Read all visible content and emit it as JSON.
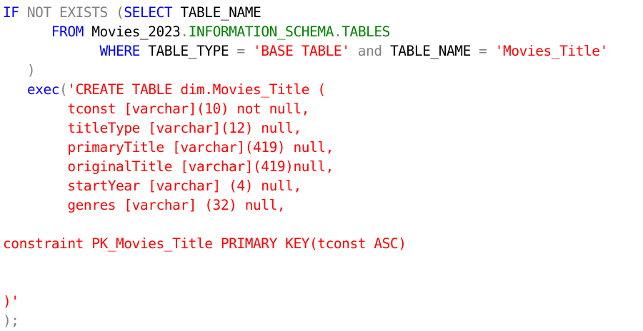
{
  "editor": {
    "colors": {
      "keyword": "#0000ff",
      "operator": "#808080",
      "system_object": "#008000",
      "string": "#ff0000",
      "identifier": "#000000"
    },
    "lines": [
      {
        "tokens": [
          {
            "text": "IF",
            "type": "kw"
          },
          {
            "text": " NOT EXISTS (",
            "type": "gray"
          },
          {
            "text": "SELECT",
            "type": "kw"
          },
          {
            "text": " TABLE_NAME",
            "type": "id"
          }
        ]
      },
      {
        "tokens": [
          {
            "text": "      ",
            "type": "id"
          },
          {
            "text": "FROM",
            "type": "kw"
          },
          {
            "text": " Movies_2023",
            "type": "id"
          },
          {
            "text": ".",
            "type": "gray"
          },
          {
            "text": "INFORMATION_SCHEMA",
            "type": "sys"
          },
          {
            "text": ".",
            "type": "gray"
          },
          {
            "text": "TABLES",
            "type": "sys"
          }
        ]
      },
      {
        "tokens": [
          {
            "text": "            ",
            "type": "id"
          },
          {
            "text": "WHERE",
            "type": "kw"
          },
          {
            "text": " TABLE_TYPE ",
            "type": "id"
          },
          {
            "text": "=",
            "type": "gray"
          },
          {
            "text": " ",
            "type": "id"
          },
          {
            "text": "'BASE TABLE'",
            "type": "str"
          },
          {
            "text": " ",
            "type": "id"
          },
          {
            "text": "and",
            "type": "gray"
          },
          {
            "text": " TABLE_NAME ",
            "type": "id"
          },
          {
            "text": "=",
            "type": "gray"
          },
          {
            "text": " ",
            "type": "id"
          },
          {
            "text": "'Movies_Title'",
            "type": "str"
          }
        ]
      },
      {
        "tokens": [
          {
            "text": "   ",
            "type": "id"
          },
          {
            "text": ")",
            "type": "gray"
          }
        ]
      },
      {
        "tokens": [
          {
            "text": "   ",
            "type": "id"
          },
          {
            "text": "exec",
            "type": "kw"
          },
          {
            "text": "(",
            "type": "gray"
          },
          {
            "text": "'CREATE TABLE dim.Movies_Title (",
            "type": "str"
          }
        ]
      },
      {
        "tokens": [
          {
            "text": "        tconst [varchar](10) not null,",
            "type": "str"
          }
        ]
      },
      {
        "tokens": [
          {
            "text": "        titleType [varchar](12) null,",
            "type": "str"
          }
        ]
      },
      {
        "tokens": [
          {
            "text": "        primaryTitle [varchar](419) null,",
            "type": "str"
          }
        ]
      },
      {
        "tokens": [
          {
            "text": "        originalTitle [varchar](419)null,",
            "type": "str"
          }
        ]
      },
      {
        "tokens": [
          {
            "text": "        startYear [varchar] (4) null,",
            "type": "str"
          }
        ]
      },
      {
        "tokens": [
          {
            "text": "        genres [varchar] (32) null,",
            "type": "str"
          }
        ]
      },
      {
        "tokens": []
      },
      {
        "tokens": [
          {
            "text": "constraint PK_Movies_Title PRIMARY KEY(tconst ASC)",
            "type": "str"
          }
        ]
      },
      {
        "tokens": []
      },
      {
        "tokens": []
      },
      {
        "tokens": [
          {
            "text": ")'",
            "type": "str"
          }
        ]
      },
      {
        "tokens": [
          {
            "text": ")",
            "type": "gray"
          },
          {
            "text": ";",
            "type": "gray"
          }
        ]
      }
    ]
  }
}
